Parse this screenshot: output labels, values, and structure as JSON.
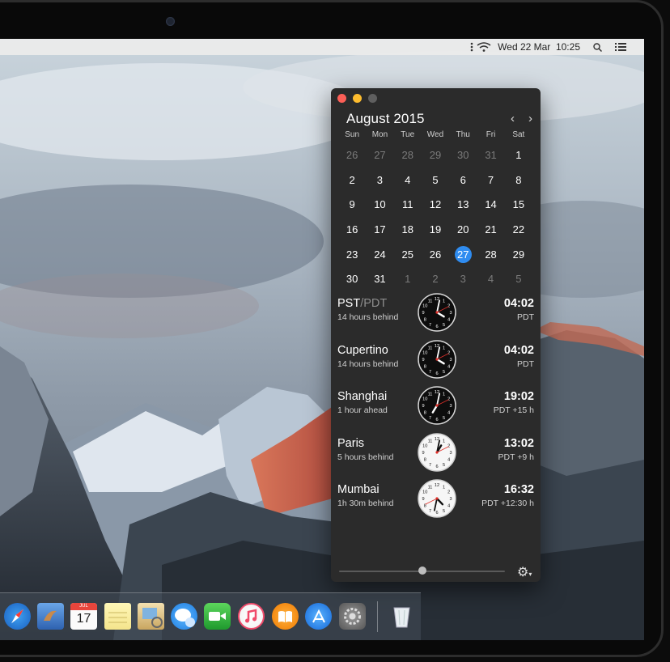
{
  "menubar": {
    "clock": "Wed 22 Mar  10:25"
  },
  "calendar": {
    "title": "August 2015",
    "weekdays": [
      "Sun",
      "Mon",
      "Tue",
      "Wed",
      "Thu",
      "Fri",
      "Sat"
    ],
    "weeks": [
      [
        "26",
        "27",
        "28",
        "29",
        "30",
        "31",
        "1"
      ],
      [
        "2",
        "3",
        "4",
        "5",
        "6",
        "7",
        "8"
      ],
      [
        "9",
        "10",
        "11",
        "12",
        "13",
        "14",
        "15"
      ],
      [
        "16",
        "17",
        "18",
        "19",
        "20",
        "21",
        "22"
      ],
      [
        "23",
        "24",
        "25",
        "26",
        "27",
        "28",
        "29"
      ],
      [
        "30",
        "31",
        "1",
        "2",
        "3",
        "4",
        "5"
      ]
    ],
    "today": "27"
  },
  "timezones": [
    {
      "name": "PST",
      "name_dim": "/PDT",
      "diff": "14 hours behind",
      "time": "04:02",
      "offset": "PDT",
      "hour": 4,
      "minute": 2,
      "night": true
    },
    {
      "name": "Cupertino",
      "name_dim": "",
      "diff": "14 hours behind",
      "time": "04:02",
      "offset": "PDT",
      "hour": 4,
      "minute": 2,
      "night": true
    },
    {
      "name": "Shanghai",
      "name_dim": "",
      "diff": "1 hour ahead",
      "time": "19:02",
      "offset": "PDT +15 h",
      "hour": 19,
      "minute": 2,
      "night": true
    },
    {
      "name": "Paris",
      "name_dim": "",
      "diff": "5 hours behind",
      "time": "13:02",
      "offset": "PDT +9 h",
      "hour": 13,
      "minute": 2,
      "night": false
    },
    {
      "name": "Mumbai",
      "name_dim": "",
      "diff": "1h 30m behind",
      "time": "16:32",
      "offset": "PDT +12:30 h",
      "hour": 16,
      "minute": 32,
      "night": false
    }
  ],
  "dock": {
    "calendar_icon_day": "17",
    "calendar_icon_month": "JUL",
    "icons": [
      "safari-icon",
      "mail-icon",
      "calendar-icon",
      "notes-icon",
      "preview-icon",
      "messages-icon",
      "facetime-icon",
      "itunes-icon",
      "ibooks-icon",
      "app-store-icon",
      "system-preferences-icon",
      "trash-icon"
    ]
  }
}
